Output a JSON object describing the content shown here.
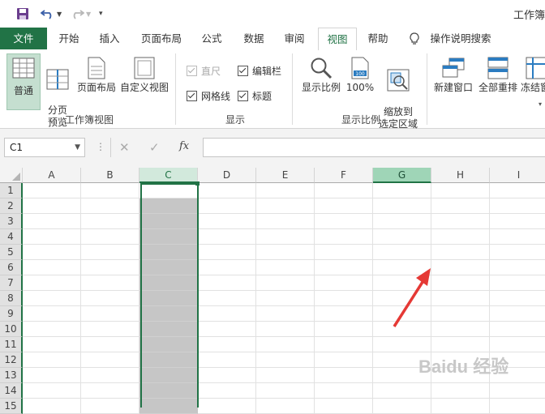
{
  "title": "工作簿",
  "tabs": [
    "文件",
    "开始",
    "插入",
    "页面布局",
    "公式",
    "数据",
    "审阅",
    "视图",
    "帮助"
  ],
  "tell_me": "操作说明搜索",
  "active_tab": "视图",
  "ribbon": {
    "workbook_views": {
      "normal": "普通",
      "page_break": "分页\n预览",
      "page_layout": "页面布局",
      "custom_views": "自定义视图",
      "label": "工作簿视图"
    },
    "show": {
      "ruler": "直尺",
      "formula_bar": "编辑栏",
      "gridlines": "网格线",
      "headings": "标题",
      "label": "显示"
    },
    "zoom": {
      "zoom": "显示比例",
      "zoom100": "100%",
      "zoom_selection": "缩放到\n选定区域",
      "label": "显示比例"
    },
    "window": {
      "new_window": "新建窗口",
      "arrange_all": "全部重排",
      "freeze": "冻结窗"
    }
  },
  "formula_bar": {
    "name_box": "C1",
    "fx": "fx"
  },
  "grid": {
    "columns": [
      "A",
      "B",
      "C",
      "D",
      "E",
      "F",
      "G",
      "H",
      "I"
    ],
    "rows": [
      "1",
      "2",
      "3",
      "4",
      "5",
      "6",
      "7",
      "8",
      "9",
      "10",
      "11",
      "12",
      "13",
      "14",
      "15"
    ],
    "selected_column": "C",
    "highlighted_column": "G"
  },
  "watermark": "Baidu 经验"
}
